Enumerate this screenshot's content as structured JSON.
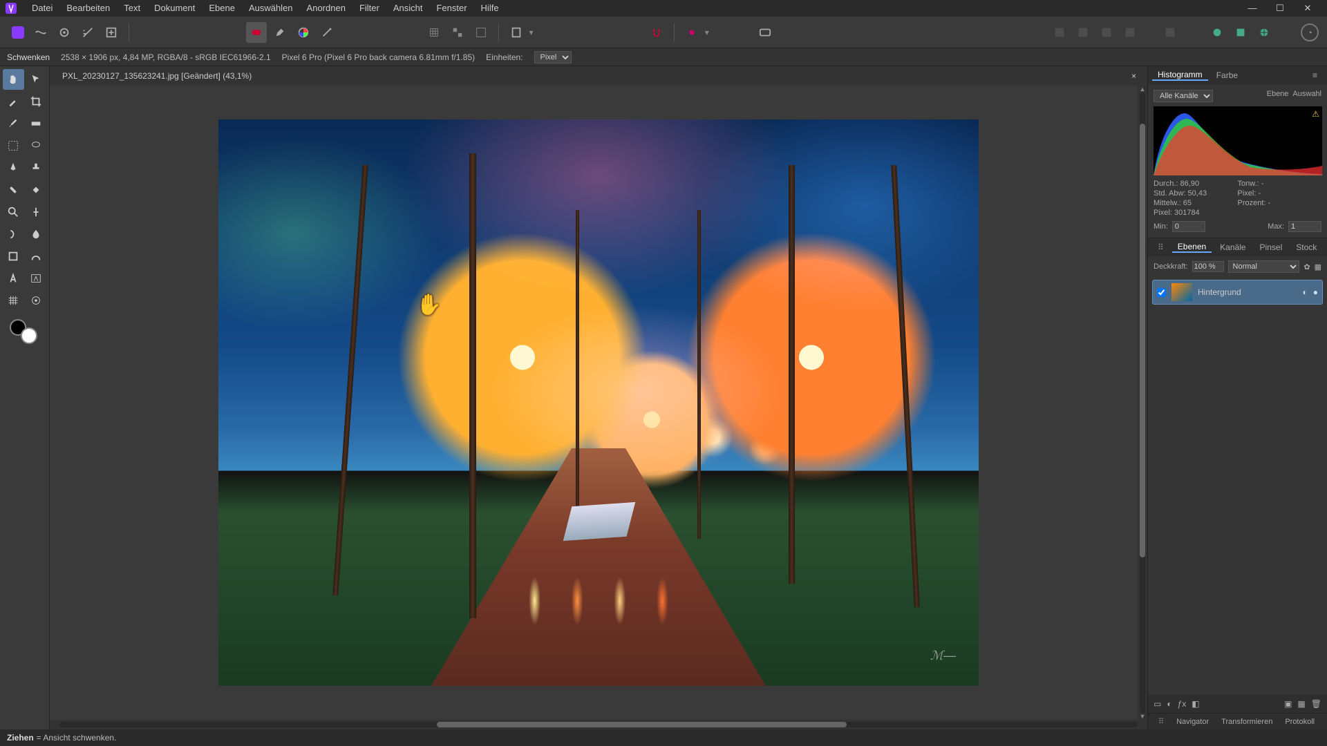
{
  "menu": {
    "items": [
      "Datei",
      "Bearbeiten",
      "Text",
      "Dokument",
      "Ebene",
      "Auswählen",
      "Anordnen",
      "Filter",
      "Ansicht",
      "Fenster",
      "Hilfe"
    ]
  },
  "window_controls": {
    "min": "—",
    "max": "☐",
    "close": "✕"
  },
  "infobar": {
    "tool": "Schwenken",
    "dims": "2538 × 1906 px, 4,84 MP, RGBA/8 - sRGB IEC61966-2.1",
    "camera": "Pixel 6 Pro (Pixel 6 Pro back camera 6.81mm f/1.85)",
    "units_label": "Einheiten:",
    "units_value": "Pixel"
  },
  "tab": {
    "title": "PXL_20230127_135623241.jpg [Geändert] (43,1%)",
    "close": "×"
  },
  "histogram": {
    "tabs": [
      "Histogramm",
      "Farbe"
    ],
    "channel": "Alle Kanäle",
    "toggles": [
      "Ebene",
      "Auswahl"
    ],
    "stats": {
      "durch_l": "Durch.:",
      "durch_v": "86,90",
      "tonw_l": "Tonw.:",
      "tonw_v": "-",
      "std_l": "Std. Abw:",
      "std_v": "50,43",
      "pix_l": "Pixel:",
      "pix_v": "-",
      "mitt_l": "Mittelw.:",
      "mitt_v": "65",
      "proz_l": "Prozent:",
      "proz_v": "-",
      "pcount_l": "Pixel:",
      "pcount_v": "301784"
    },
    "min_l": "Min:",
    "min_v": "0",
    "max_l": "Max:",
    "max_v": "1"
  },
  "layers": {
    "tabs": [
      "Ebenen",
      "Kanäle",
      "Pinsel",
      "Stock"
    ],
    "opacity_l": "Deckkraft:",
    "opacity_v": "100 %",
    "blend": "Normal",
    "layer0": "Hintergrund"
  },
  "bottom_tabs": [
    "Navigator",
    "Transformieren",
    "Protokoll"
  ],
  "status": {
    "verb": "Ziehen",
    "rest": " = Ansicht schwenken."
  }
}
